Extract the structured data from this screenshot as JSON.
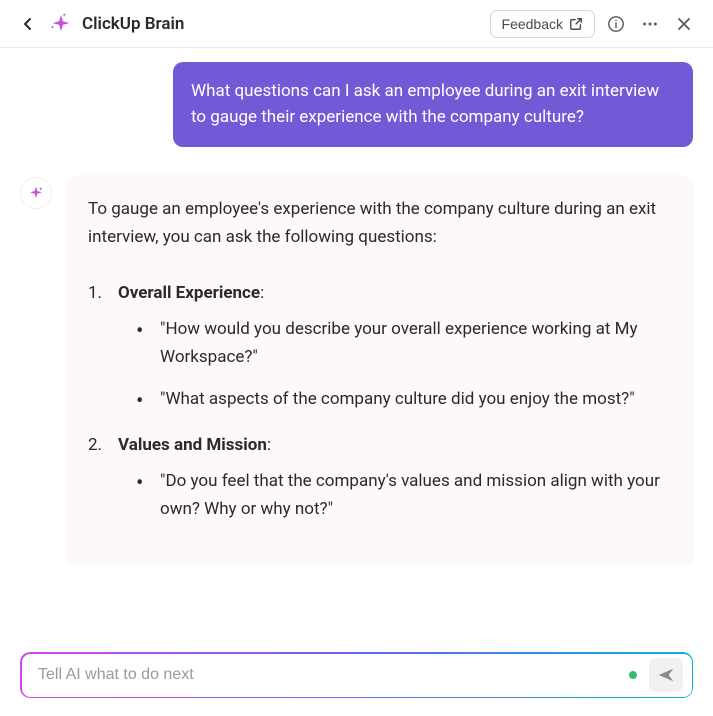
{
  "header": {
    "title": "ClickUp Brain",
    "feedback_label": "Feedback"
  },
  "chat": {
    "user_message": "What questions can I ask an employee during an exit interview to gauge their experience with the company culture?",
    "ai_intro": "To gauge an employee's experience with the company culture during an exit interview, you can ask the following questions:",
    "sections": [
      {
        "num": "1.",
        "heading": "Overall Experience",
        "bullets": [
          "\"How would you describe your overall experience working at My Workspace?\"",
          "\"What aspects of the company culture did you enjoy the most?\""
        ]
      },
      {
        "num": "2.",
        "heading": "Values and Mission",
        "bullets": [
          "\"Do you feel that the company's values and mission align with your own? Why or why not?\""
        ]
      }
    ]
  },
  "input": {
    "placeholder": "Tell AI what to do next"
  }
}
